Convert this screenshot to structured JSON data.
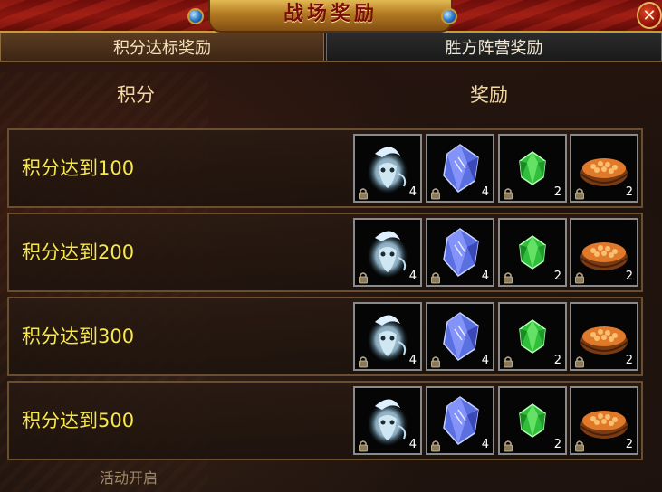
{
  "window": {
    "title": "战场奖励",
    "close_label": "✕"
  },
  "tabs": [
    {
      "label": "积分达标奖励",
      "active": true
    },
    {
      "label": "胜方阵营奖励",
      "active": false
    }
  ],
  "columns": {
    "score": "积分",
    "reward": "奖励"
  },
  "rows": [
    {
      "label": "积分达到100",
      "items": [
        {
          "icon": "spirit-beast-icon",
          "count": "4",
          "bound": true
        },
        {
          "icon": "blue-crystal-icon",
          "count": "4",
          "bound": true
        },
        {
          "icon": "green-gem-icon",
          "count": "2",
          "bound": true
        },
        {
          "icon": "food-bowl-icon",
          "count": "2",
          "bound": true
        }
      ]
    },
    {
      "label": "积分达到200",
      "items": [
        {
          "icon": "spirit-beast-icon",
          "count": "4",
          "bound": true
        },
        {
          "icon": "blue-crystal-icon",
          "count": "4",
          "bound": true
        },
        {
          "icon": "green-gem-icon",
          "count": "2",
          "bound": true
        },
        {
          "icon": "food-bowl-icon",
          "count": "2",
          "bound": true
        }
      ]
    },
    {
      "label": "积分达到300",
      "items": [
        {
          "icon": "spirit-beast-icon",
          "count": "4",
          "bound": true
        },
        {
          "icon": "blue-crystal-icon",
          "count": "4",
          "bound": true
        },
        {
          "icon": "green-gem-icon",
          "count": "2",
          "bound": true
        },
        {
          "icon": "food-bowl-icon",
          "count": "2",
          "bound": true
        }
      ]
    },
    {
      "label": "积分达到500",
      "items": [
        {
          "icon": "spirit-beast-icon",
          "count": "4",
          "bound": true
        },
        {
          "icon": "blue-crystal-icon",
          "count": "4",
          "bound": true
        },
        {
          "icon": "green-gem-icon",
          "count": "2",
          "bound": true
        },
        {
          "icon": "food-bowl-icon",
          "count": "2",
          "bound": true
        }
      ]
    }
  ],
  "footer": {
    "text": "活动开启"
  },
  "colors": {
    "label_yellow": "#f7e84a",
    "title_red": "#7a0e05",
    "gold_border": "#c89a3a"
  }
}
